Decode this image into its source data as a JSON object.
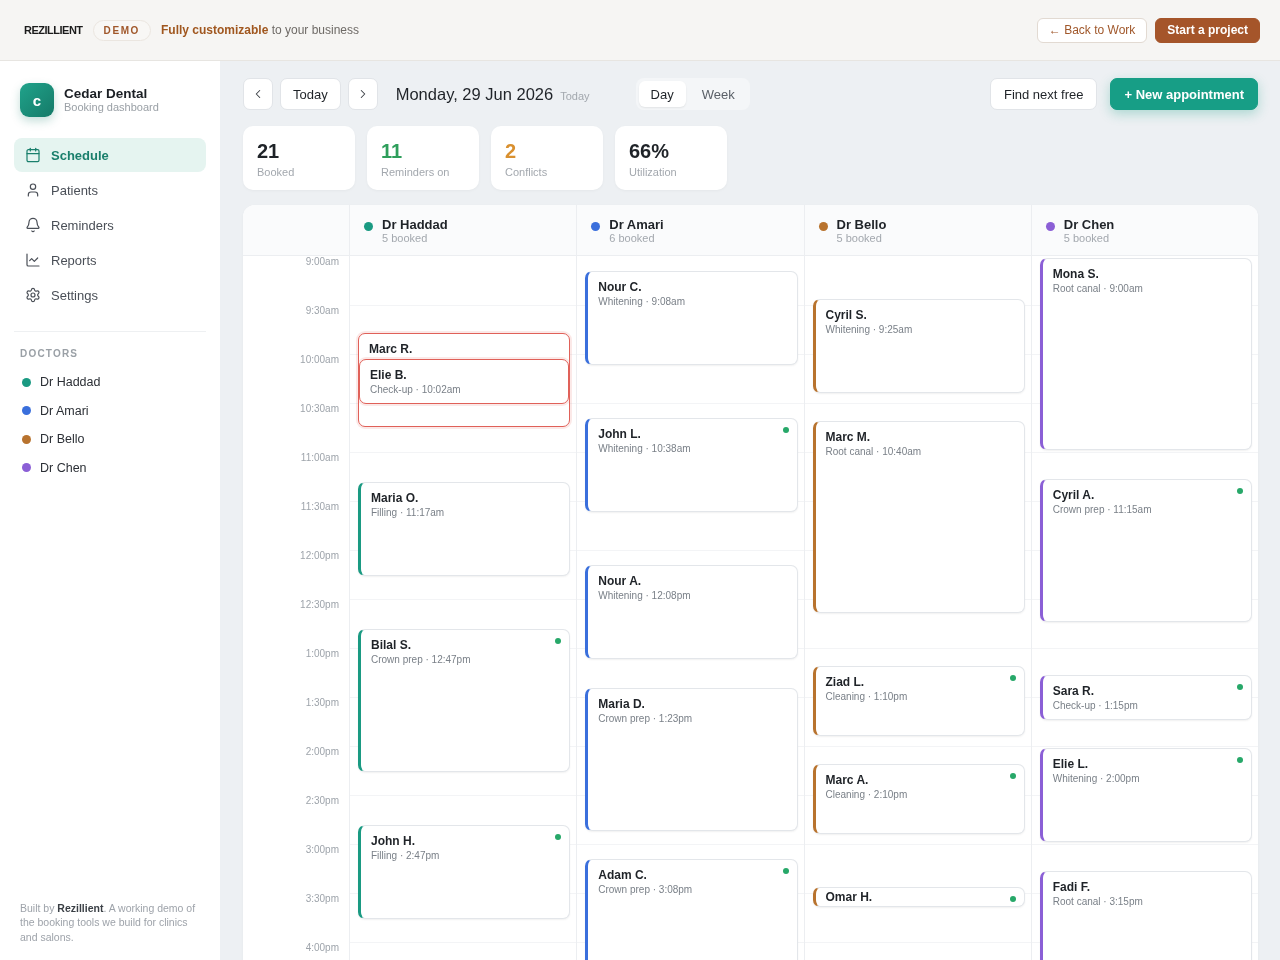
{
  "top_bar": {
    "logo": "REZILLIENT",
    "badge": "DEMO",
    "tagline": "**Fully customizable** to your business",
    "buttons": [
      {
        "label": "← Back to Work",
        "kind": "outline"
      },
      {
        "label": "Start a project",
        "kind": "primary"
      }
    ]
  },
  "sidebar": {
    "brand": {
      "initial": "c",
      "name": "Cedar Dental",
      "subtitle": "Booking dashboard"
    },
    "nav": [
      {
        "label": "Schedule",
        "selected": true
      },
      {
        "label": "Patients",
        "selected": false
      },
      {
        "label": "Reminders",
        "selected": false
      },
      {
        "label": "Reports",
        "selected": false
      },
      {
        "label": "Settings",
        "selected": false
      }
    ],
    "doctors_heading": "DOCTORS",
    "doctors": [
      {
        "name": "Dr Haddad",
        "color": "#1a9a82"
      },
      {
        "name": "Dr Amari",
        "color": "#3a6fdc"
      },
      {
        "name": "Dr Bello",
        "color": "#b8732e"
      },
      {
        "name": "Dr Chen",
        "color": "#8b5fd6"
      }
    ],
    "footer": "Built by **Rezillient**. A working demo of the booking tools we build for clinics and salons."
  },
  "toolbar": {
    "today_button": "Today",
    "date": "Monday, 29 Jun 2026",
    "date_hint": "Today",
    "views": [
      {
        "label": "Day",
        "selected": true
      },
      {
        "label": "Week",
        "selected": false
      }
    ],
    "actions": [
      {
        "label": "Find next free",
        "kind": "secondary"
      },
      {
        "label": "+ New appointment",
        "kind": "primary"
      }
    ]
  },
  "stats": [
    {
      "value": "21",
      "label": "Booked",
      "color": "#1f2328"
    },
    {
      "value": "11",
      "label": "Reminders on",
      "color": "#2e9e5b"
    },
    {
      "value": "2",
      "label": "Conflicts",
      "color": "#d9902f"
    },
    {
      "value": "66%",
      "label": "Utilization",
      "color": "#1f2328"
    }
  ],
  "calendar": {
    "times": [
      "9:00am",
      "9:30am",
      "10:00am",
      "10:30am",
      "11:00am",
      "11:30am",
      "12:00pm",
      "12:30pm",
      "1:00pm",
      "1:30pm",
      "2:00pm",
      "2:30pm",
      "3:00pm",
      "3:30pm",
      "4:00pm"
    ],
    "columns": [
      {
        "doctor": "Dr Haddad",
        "booked": "5 booked",
        "color": "#1a9a82",
        "appointments": [
          {
            "patient": "Marc R.",
            "conflict": true,
            "reminder": false
          },
          {
            "patient": "Elie B.",
            "detail": "Check-up · 10:02am",
            "conflict": true,
            "reminder": false
          },
          {
            "patient": "Maria O.",
            "detail": "Filling · 11:17am",
            "conflict": false,
            "reminder": false
          },
          {
            "patient": "Bilal S.",
            "detail": "Crown prep · 12:47pm",
            "conflict": false,
            "reminder": true
          },
          {
            "patient": "John H.",
            "detail": "Filling · 2:47pm",
            "conflict": false,
            "reminder": true
          }
        ]
      },
      {
        "doctor": "Dr Amari",
        "booked": "6 booked",
        "color": "#3a6fdc",
        "appointments": [
          {
            "patient": "Nour C.",
            "detail": "Whitening · 9:08am",
            "conflict": false,
            "reminder": false
          },
          {
            "patient": "John L.",
            "detail": "Whitening · 10:38am",
            "conflict": false,
            "reminder": true
          },
          {
            "patient": "Nour A.",
            "detail": "Whitening · 12:08pm",
            "conflict": false,
            "reminder": false
          },
          {
            "patient": "Maria D.",
            "detail": "Crown prep · 1:23pm",
            "conflict": false,
            "reminder": false
          },
          {
            "patient": "Adam C.",
            "detail": "Crown prep · 3:08pm",
            "conflict": false,
            "reminder": true
          }
        ]
      },
      {
        "doctor": "Dr Bello",
        "booked": "5 booked",
        "color": "#b8732e",
        "appointments": [
          {
            "patient": "Cyril S.",
            "detail": "Whitening · 9:25am",
            "conflict": false,
            "reminder": false
          },
          {
            "patient": "Marc M.",
            "detail": "Root canal · 10:40am",
            "conflict": false,
            "reminder": false
          },
          {
            "patient": "Ziad L.",
            "detail": "Cleaning · 1:10pm",
            "conflict": false,
            "reminder": true
          },
          {
            "patient": "Marc A.",
            "detail": "Cleaning · 2:10pm",
            "conflict": false,
            "reminder": true
          },
          {
            "patient": "Omar H.",
            "conflict": false,
            "reminder": true
          }
        ]
      },
      {
        "doctor": "Dr Chen",
        "booked": "5 booked",
        "color": "#8b5fd6",
        "appointments": [
          {
            "patient": "Mona S.",
            "detail": "Root canal · 9:00am",
            "conflict": false,
            "reminder": false
          },
          {
            "patient": "Cyril A.",
            "detail": "Crown prep · 11:15am",
            "conflict": false,
            "reminder": true
          },
          {
            "patient": "Sara R.",
            "detail": "Check-up · 1:15pm",
            "conflict": false,
            "reminder": true
          },
          {
            "patient": "Elie L.",
            "detail": "Whitening · 2:00pm",
            "conflict": false,
            "reminder": true
          },
          {
            "patient": "Fadi F.",
            "detail": "Root canal · 3:15pm",
            "conflict": false,
            "reminder": false
          }
        ]
      }
    ]
  }
}
